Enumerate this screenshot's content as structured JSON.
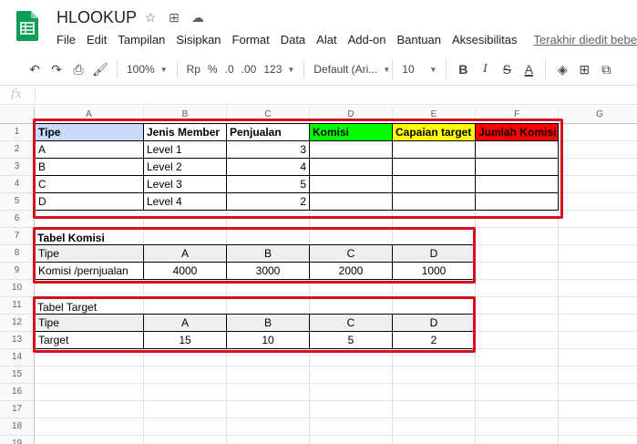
{
  "app": {
    "title": "HLOOKUP",
    "last_edit": "Terakhir diedit bebe"
  },
  "menu": [
    "File",
    "Edit",
    "Tampilan",
    "Sisipkan",
    "Format",
    "Data",
    "Alat",
    "Add-on",
    "Bantuan",
    "Aksesibilitas"
  ],
  "toolbar": {
    "zoom": "100%",
    "currency": "Rp",
    "percent": "%",
    "dec_decrease": ".0",
    "dec_increase": ".00",
    "more_formats": "123",
    "font": "Default (Ari...",
    "font_size": "10"
  },
  "formula_bar": {
    "fx": "fx",
    "value": ""
  },
  "columns": [
    "A",
    "B",
    "C",
    "D",
    "E",
    "F",
    "G"
  ],
  "rows": [
    "1",
    "2",
    "3",
    "4",
    "5",
    "6",
    "7",
    "8",
    "9",
    "10",
    "11",
    "12",
    "13",
    "14",
    "15",
    "16",
    "17",
    "18",
    "19"
  ],
  "table_main": {
    "headers": [
      "Tipe",
      "Jenis Member",
      "Penjualan",
      "Komisi",
      "Capaian target",
      "Jumlah Komisi"
    ],
    "header_colors": [
      "#c9daf8",
      "#ffffff",
      "#ffffff",
      "#00ff00",
      "#ffff00",
      "#ff0000"
    ],
    "rows": [
      [
        "A",
        "Level 1",
        "3",
        "",
        "",
        ""
      ],
      [
        "B",
        "Level 2",
        "4",
        "",
        "",
        ""
      ],
      [
        "C",
        "Level 3",
        "5",
        "",
        "",
        ""
      ],
      [
        "D",
        "Level 4",
        "2",
        "",
        "",
        ""
      ]
    ]
  },
  "table_komisi": {
    "title": "Tabel Komisi",
    "header": [
      "Tipe",
      "A",
      "B",
      "C",
      "D"
    ],
    "row": [
      "Komisi /pernjualan",
      "4000",
      "3000",
      "2000",
      "1000"
    ]
  },
  "table_target": {
    "title": "Tabel Target",
    "header": [
      "Tipe",
      "A",
      "B",
      "C",
      "D"
    ],
    "row": [
      "Target",
      "15",
      "10",
      "5",
      "2"
    ]
  },
  "colors": {
    "highlight_box": "#d40f1f",
    "header_gray": "#efefef",
    "sheets_green": "#0f9d58"
  }
}
